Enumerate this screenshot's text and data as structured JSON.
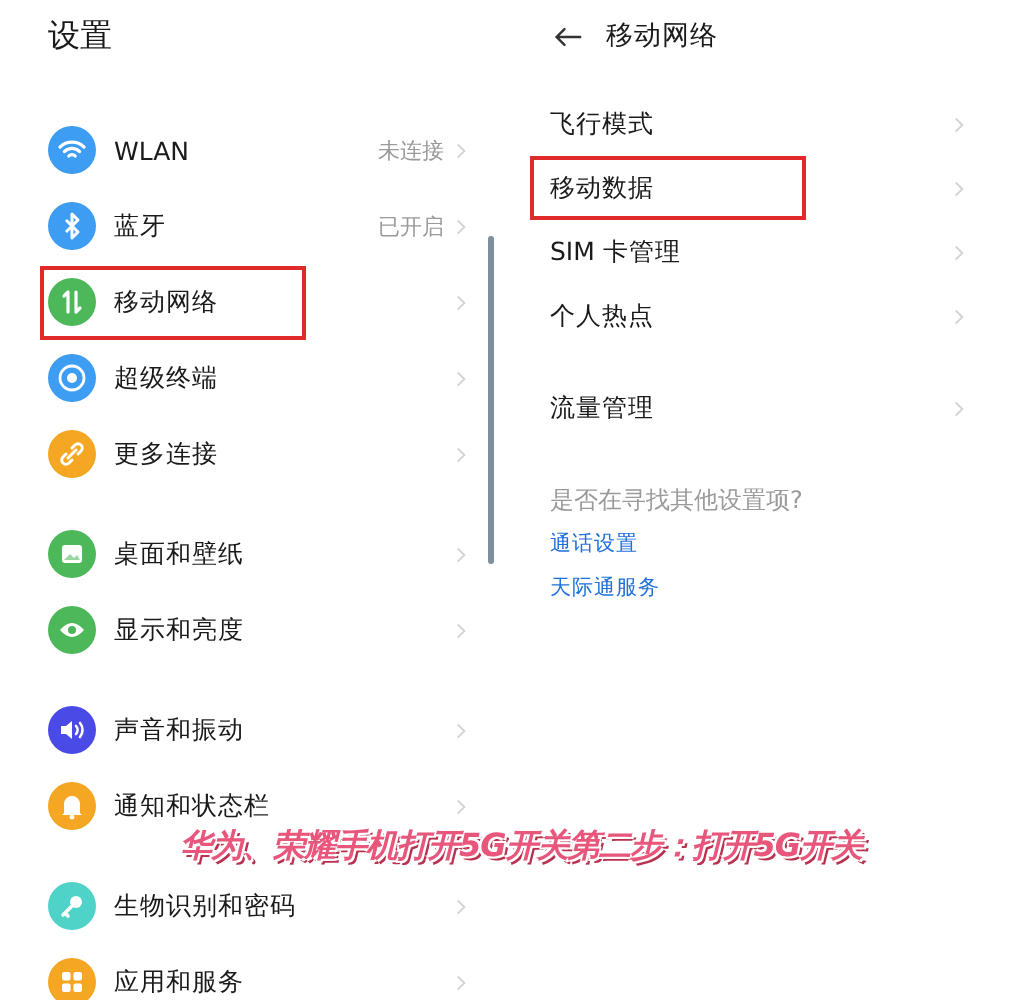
{
  "settings": {
    "title": "设置",
    "groups": [
      [
        {
          "label": "WLAN",
          "value": "未连接",
          "color": "#3d9df2",
          "highlighted": false
        },
        {
          "label": "蓝牙",
          "value": "已开启",
          "color": "#3d9df2",
          "highlighted": false
        },
        {
          "label": "移动网络",
          "color": "#4cb85a",
          "highlighted": true
        },
        {
          "label": "超级终端",
          "color": "#3d9df2",
          "highlighted": false
        },
        {
          "label": "更多连接",
          "color": "#f5a623",
          "highlighted": false
        }
      ],
      [
        {
          "label": "桌面和壁纸",
          "color": "#4cb85a",
          "highlighted": false
        },
        {
          "label": "显示和亮度",
          "color": "#4cb85a",
          "highlighted": false
        }
      ],
      [
        {
          "label": "声音和振动",
          "color": "#4a4ae6",
          "highlighted": false
        },
        {
          "label": "通知和状态栏",
          "color": "#f5a623",
          "highlighted": false
        }
      ],
      [
        {
          "label": "生物识别和密码",
          "color": "#4fd3c9",
          "highlighted": false
        },
        {
          "label": "应用和服务",
          "color": "#f5a623",
          "highlighted": false
        }
      ]
    ]
  },
  "mobile_network": {
    "title": "移动网络",
    "groups": [
      [
        {
          "label": "飞行模式",
          "highlighted": false
        },
        {
          "label": "移动数据",
          "highlighted": true
        },
        {
          "label": "SIM 卡管理",
          "highlighted": false
        },
        {
          "label": "个人热点",
          "highlighted": false
        }
      ],
      [
        {
          "label": "流量管理",
          "highlighted": false
        }
      ]
    ],
    "hint": "是否在寻找其他设置项?",
    "links": [
      "通话设置",
      "天际通服务"
    ]
  },
  "caption": "华为、荣耀手机打开5G开关第二步：打开5G开关"
}
